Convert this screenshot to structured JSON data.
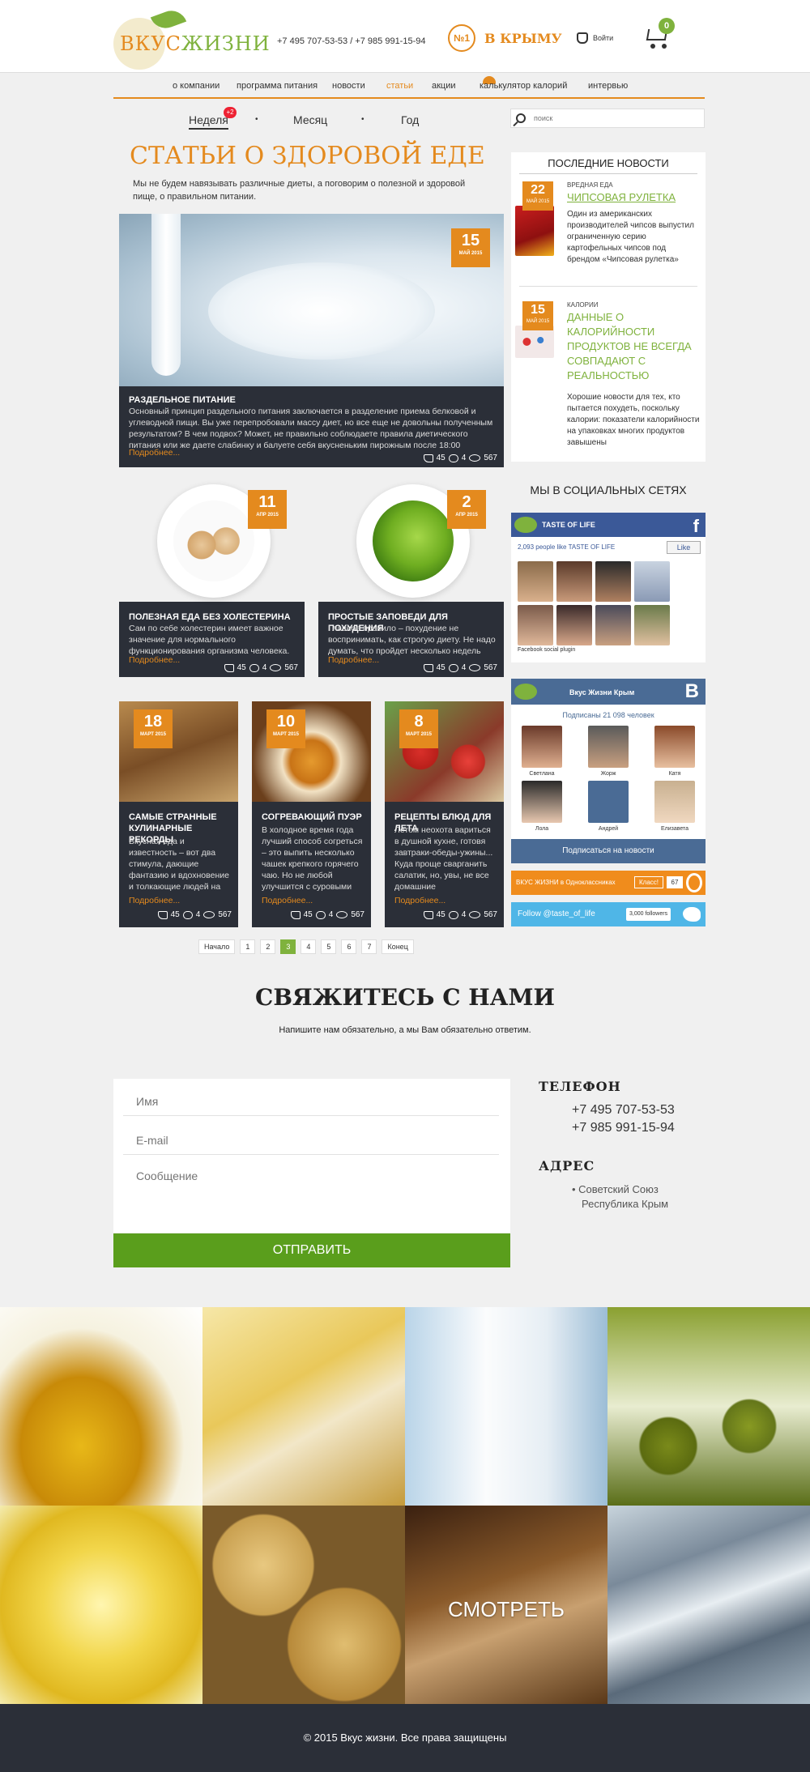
{
  "header": {
    "logo_text_1": "ВКУС",
    "logo_text_2": "ЖИЗНИ",
    "phones": "+7 495 707-53-53 / +7 985 991-15-94",
    "no1": "№1",
    "crimea": "В КРЫМУ",
    "login": "Войти",
    "cart_count": "0"
  },
  "nav": {
    "items": [
      "о компании",
      "программа питания",
      "новости",
      "статьи",
      "акции",
      "калькулятор калорий",
      "интервью"
    ],
    "active": "статьи"
  },
  "periods": {
    "week": "Неделя",
    "week_badge": "+2",
    "month": "Месяц",
    "year": "Год",
    "dot": "•"
  },
  "search": {
    "placeholder": "поиск"
  },
  "main": {
    "title": "СТАТЬИ О ЗДОРОВОЙ ЕДЕ",
    "intro": "Мы не будем навязывать различные диеты, а поговорим о полезной и здоровой пище, о правильном питании."
  },
  "articles": [
    {
      "day": "15",
      "month": "МАЙ 2015",
      "title": "РАЗДЕЛЬНОЕ ПИТАНИЕ",
      "text": "Основный принцип раздельного питания заключается в разделение приема белковой и углеводной пищи.  Вы уже перепробовали массу диет, но все еще не довольны полученным результатом? В чем подвох? Может, не правильно соблюдаете правила диетического питания или же даете слабинку и балуете себя вкусненьким пирожным после 18:00",
      "more": "Подробнее...",
      "likes": "45",
      "comments": "4",
      "views": "567"
    },
    {
      "day": "11",
      "month": "АПР 2015",
      "title": "ПОЛЕЗНАЯ ЕДА БЕЗ ХОЛЕСТЕРИНА",
      "text": "Сам по себе холестерин имеет важное значение для нормального функционирования организма человека.",
      "more": "Подробнее...",
      "likes": "45",
      "comments": "4",
      "views": "567"
    },
    {
      "day": "2",
      "month": "АПР 2015",
      "title": "ПРОСТЫЕ ЗАПОВЕДИ ДЛЯ ПОХУДЕНИЯ",
      "text": "Главное правило – похудение не воспринимать, как строгую диету. Не надо думать, что пройдет несколько недель",
      "more": "Подробнее...",
      "likes": "45",
      "comments": "4",
      "views": "567"
    },
    {
      "day": "18",
      "month": "МАРТ 2015",
      "title": "САМЫЕ СТРАННЫЕ КУЛИНАРНЫЕ РЕКОРДЫ",
      "text": "Вкусная еда и известность – вот два стимула, дающие фантазию и вдохновение и толкающие людей на странные поступки.",
      "more": "Подробнее...",
      "likes": "45",
      "comments": "4",
      "views": "567"
    },
    {
      "day": "10",
      "month": "МАРТ 2015",
      "title": "СОГРЕВАЮЩИЙ ПУЭР",
      "text": "В холодное время года лучший способ согреться – это выпить несколько чашек крепкого горячего чаю. Но не любой улучшится с суровыми",
      "more": "Подробнее...",
      "likes": "45",
      "comments": "4",
      "views": "567"
    },
    {
      "day": "8",
      "month": "МАРТ 2015",
      "title": "РЕЦЕПТЫ БЛЮД ДЛЯ ЛЕТА",
      "text": "Летом неохота вариться в душной кухне, готовя завтраки-обеды-ужины... Куда проще сварганить салатик, но, увы, не все домашние",
      "more": "Подробнее...",
      "likes": "45",
      "comments": "4",
      "views": "567"
    }
  ],
  "sidebar": {
    "news_title": "ПОСЛЕДНИЕ НОВОСТИ",
    "news": [
      {
        "day": "22",
        "month": "МАЙ 2015",
        "category": "ВРЕДНАЯ ЕДА",
        "title": "ЧИПСОВАЯ РУЛЕТКА",
        "text": "Один из американских производителей чипсов выпустил ограниченную серию картофельных чипсов под брендом «Чипсовая рулетка»"
      },
      {
        "day": "15",
        "month": "МАЙ 2015",
        "category": "КАЛОРИИ",
        "title": "ДАННЫЕ О КАЛОРИЙНОСТИ ПРОДУКТОВ НЕ ВСЕГДА СОВПАДАЮТ С РЕАЛЬНОСТЬЮ",
        "text": "Хорошие новости для тех, кто пытается похудеть, поскольку калории: показатели калорийности на упаковках многих продуктов завышены"
      }
    ],
    "social_title": "МЫ В СОЦИАЛЬНЫХ СЕТЯХ",
    "fb": {
      "name": "TASTE OF LIFE",
      "f": "f",
      "count": "2,093 people like TASTE OF LIFE",
      "like": "Like",
      "plugin": "Facebook social plugin"
    },
    "vk": {
      "name": "Вкус Жизни  Крым",
      "b": "B",
      "subs": "Подписаны 21 098 человек",
      "people": [
        "Светлана",
        "Жорж",
        "Катя",
        "Лола",
        "Андрей",
        "Елизавета"
      ],
      "subscribe": "Подписаться на новости"
    },
    "ok": {
      "text": "ВКУС ЖИЗНИ в Одноклассниках",
      "klass": "Класс!",
      "count": "67"
    },
    "tw": {
      "text": "Follow  @taste_of_life",
      "followers": "3,000 followers"
    }
  },
  "pager": [
    "Начало",
    "1",
    "2",
    "3",
    "4",
    "5",
    "6",
    "7",
    "Конец"
  ],
  "pager_current": "3",
  "contact": {
    "title": "СВЯЖИТЕСЬ С НАМИ",
    "subtitle": "Напишите нам обязательно, а мы Вам обязательно ответим.",
    "name_placeholder": "Имя",
    "email_placeholder": "E-mail",
    "message_placeholder": "Сообщение",
    "send": "ОТПРАВИТЬ",
    "phone_title": "ТЕЛЕФОН",
    "phone1": "+7 495 707-53-53",
    "phone2": "+7 985 991-15-94",
    "address_title": "АДРЕС",
    "address1": "Советский Союз",
    "address2": "Республика Крым"
  },
  "gallery": {
    "watch": "СМОТРЕТЬ"
  },
  "footer": {
    "copyright": "© 2015 Вкус жизни. Все права защищены"
  },
  "colors": {
    "accent": "#e48a1e",
    "green": "#7fb23d",
    "dark": "#2b2f38",
    "button": "#5a9e1c"
  }
}
